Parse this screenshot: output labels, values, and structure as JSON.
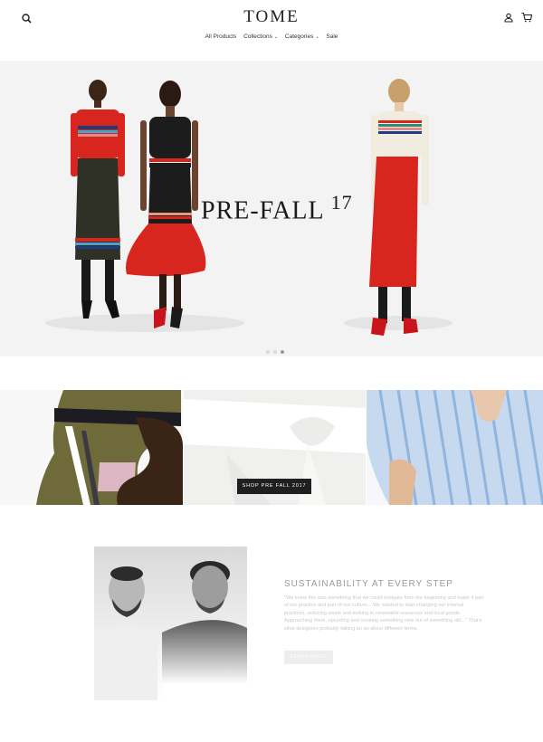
{
  "header": {
    "logo": "TOME",
    "search_icon": "search-icon",
    "account_icon": "account-icon",
    "cart_icon": "cart-icon"
  },
  "nav": {
    "items": [
      {
        "label": "All Products",
        "has_dropdown": false
      },
      {
        "label": "Collections",
        "has_dropdown": true
      },
      {
        "label": "Categories",
        "has_dropdown": true
      },
      {
        "label": "Sale",
        "has_dropdown": false
      }
    ]
  },
  "hero": {
    "title": "PRE-FALL",
    "title_suffix": "17",
    "slide_count": 3,
    "active_slide": 3
  },
  "collage": {
    "button_label": "SHOP PRE FALL 2017"
  },
  "sustainability": {
    "title": "SUSTAINABILITY AT EVERY STEP",
    "body": "\"We knew this was something that we could instigate from the beginning and make it part of our practice and part of our culture... We wanted to start changing our internal practices, reducing waste and looking to renewable resources and local goods. Approaching them, upcycling and creating something new out of something old...\" That's what designers probably talking on so about different terms.",
    "button_label": "LEARN MORE"
  },
  "colors": {
    "accent_red": "#d8261f",
    "button_dark": "#1f1f1f",
    "hero_bg": "#f3f3f3"
  }
}
